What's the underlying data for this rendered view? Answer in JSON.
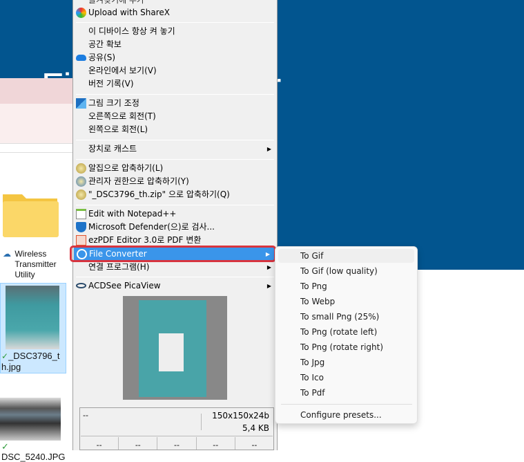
{
  "background": {
    "title_start": "Fil",
    "title_end": "r",
    "accent": "#02558f"
  },
  "explorer": {
    "items": [
      {
        "label": "Wireless Transmitter Utility",
        "type": "folder",
        "status": "cloud-icon"
      },
      {
        "label": "_DSC3796_th.jpg",
        "type": "image",
        "status": "synced-check-icon",
        "selected": true
      },
      {
        "label": "DSC_5240.JPG",
        "type": "image",
        "status": "synced-check-icon"
      }
    ]
  },
  "context_menu": {
    "top_partial": "즐겨찾기에 추가",
    "groups": [
      [
        {
          "label": "Upload with ShareX",
          "icon": "sharex-icon"
        }
      ],
      [
        {
          "label": "이 디바이스 항상 켜 놓기"
        },
        {
          "label": "공간 확보"
        },
        {
          "label": "공유(S)",
          "icon": "onedrive-icon"
        },
        {
          "label": "온라인에서 보기(V)"
        },
        {
          "label": "버전 기록(V)"
        }
      ],
      [
        {
          "label": "그림 크기 조정",
          "icon": "image-resize-icon"
        },
        {
          "label": "오른쪽으로 회전(T)"
        },
        {
          "label": "왼쪽으로 회전(L)"
        }
      ],
      [
        {
          "label": "장치로 캐스트",
          "submenu": true
        }
      ],
      [
        {
          "label": "알집으로 압축하기(L)",
          "icon": "alzip-icon"
        },
        {
          "label": "관리자 권한으로 압축하기(Y)",
          "icon": "alzip-admin-icon"
        },
        {
          "label": "\"_DSC3796_th.zip\" 으로 압축하기(Q)",
          "icon": "alzip-icon"
        }
      ],
      [
        {
          "label": "Edit with Notepad++",
          "icon": "notepadpp-icon"
        },
        {
          "label": "Microsoft Defender(으)로 검사...",
          "icon": "defender-icon"
        },
        {
          "label": "ezPDF Editor 3.0로 PDF 변환",
          "icon": "ezpdf-icon"
        },
        {
          "label": "File Converter",
          "icon": "file-converter-icon",
          "submenu": true,
          "highlighted": true
        },
        {
          "label": "연결 프로그램(H)",
          "submenu": true
        }
      ],
      [
        {
          "label": "ACDSee PicaView",
          "icon": "acdsee-icon",
          "submenu": true
        }
      ]
    ],
    "picaview": {
      "info_left": "--",
      "dimensions": "150x150x24b",
      "size": "5,4 KB",
      "cells": [
        "--",
        "--",
        "--",
        "--",
        "--"
      ]
    }
  },
  "submenu": {
    "items": [
      "To Gif",
      "To Gif (low quality)",
      "To Png",
      "To Webp",
      "To small Png (25%)",
      "To Png (rotate left)",
      "To Png (rotate right)",
      "To Jpg",
      "To Ico",
      "To Pdf"
    ],
    "configure": "Configure presets..."
  }
}
